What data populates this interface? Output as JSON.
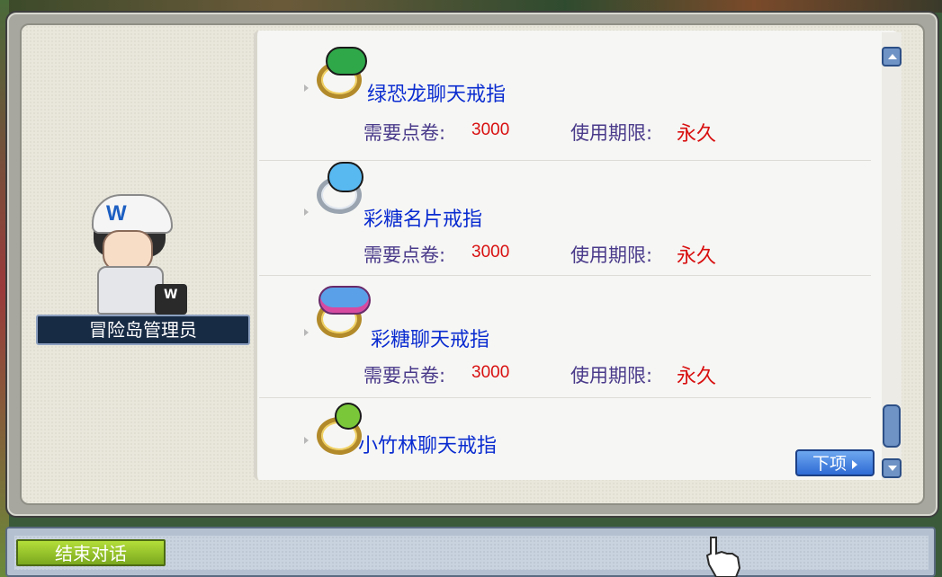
{
  "npc": {
    "name": "冒险岛管理员",
    "hat_letter": "W",
    "case_letter": "W"
  },
  "items": [
    {
      "name": "绿恐龙聊天戒指",
      "price_label": "需要点卷:",
      "price": "3000",
      "period_label": "使用期限:",
      "period": "永久",
      "icon": "green-dino-ring-icon",
      "gem_color": "#2fa84a"
    },
    {
      "name": "彩糖名片戒指",
      "price_label": "需要点卷:",
      "price": "3000",
      "period_label": "使用期限:",
      "period": "永久",
      "icon": "candy-card-ring-icon",
      "gem_color": "#58b8f0"
    },
    {
      "name": "彩糖聊天戒指",
      "price_label": "需要点卷:",
      "price": "3000",
      "period_label": "使用期限:",
      "period": "永久",
      "icon": "candy-chat-ring-icon",
      "gem_color": "#5aa0e8"
    },
    {
      "name": "小竹林聊天戒指",
      "icon": "bamboo-ring-icon",
      "gem_color": "#7ac83a"
    }
  ],
  "buttons": {
    "next": "下项",
    "end_chat": "结束对话"
  },
  "colors": {
    "item_name": "#0a2cd0",
    "label": "#4a3a8a",
    "value": "#d81010",
    "scroll_blue": "#6f93c5",
    "end_button": "#9ccc2a"
  }
}
